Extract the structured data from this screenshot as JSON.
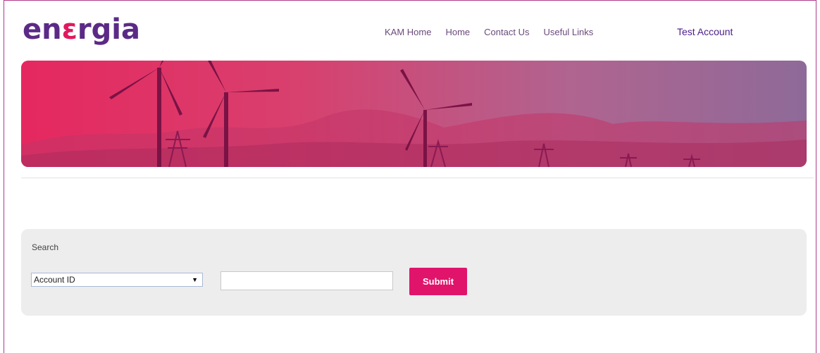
{
  "brand": {
    "logo_prefix": "en",
    "logo_accent": "ε",
    "logo_suffix": "rgia",
    "primary_color": "#5b2a86",
    "accent_color": "#e0195f"
  },
  "nav": {
    "items": [
      {
        "label": "KAM Home"
      },
      {
        "label": "Home"
      },
      {
        "label": "Contact Us"
      },
      {
        "label": "Useful Links"
      }
    ],
    "account_label": "Test Account"
  },
  "search": {
    "title": "Search",
    "select_value": "Account ID",
    "input_value": "",
    "submit_label": "Submit",
    "submit_color": "#e0146b"
  }
}
